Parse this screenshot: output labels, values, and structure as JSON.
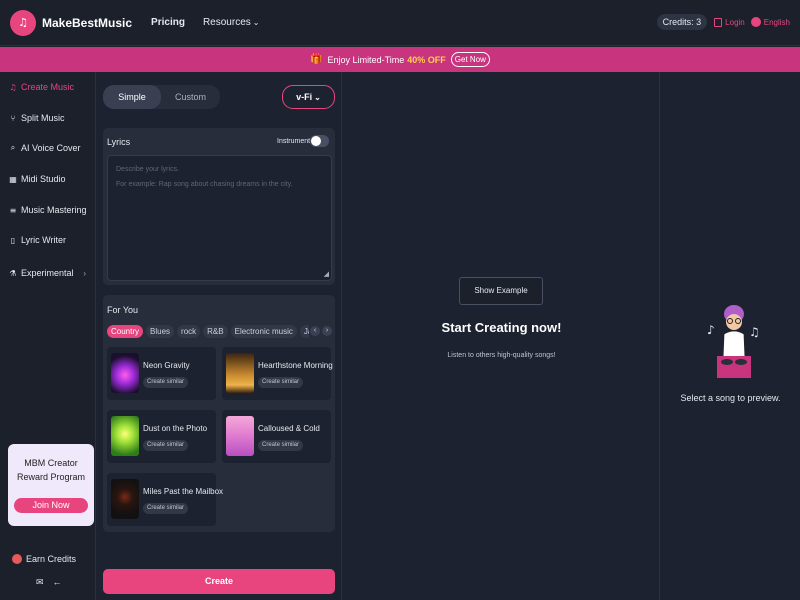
{
  "header": {
    "brand": "MakeBestMusic",
    "nav": [
      {
        "label": "Pricing"
      },
      {
        "label": "Resources"
      }
    ],
    "credits": "Credits: 3",
    "login": "Login",
    "language": "English"
  },
  "banner": {
    "prefix": "Enjoy Limited-Time",
    "highlight": "40% OFF",
    "cta": "Get Now"
  },
  "sidebar": {
    "items": [
      {
        "label": "Create Music",
        "icon": "music-note-icon",
        "active": true
      },
      {
        "label": "Split Music",
        "icon": "split-icon"
      },
      {
        "label": "AI Voice Cover",
        "icon": "microphone-icon"
      },
      {
        "label": "Midi Studio",
        "icon": "midi-icon"
      },
      {
        "label": "Music Mastering",
        "icon": "equalizer-icon"
      },
      {
        "label": "Lyric Writer",
        "icon": "document-icon"
      },
      {
        "label": "Experimental",
        "icon": "flask-icon"
      }
    ],
    "reward": {
      "line1": "MBM Creator",
      "line2": "Reward Program",
      "cta": "Join Now"
    },
    "earn_credits": "Earn Credits"
  },
  "composer": {
    "modes": {
      "simple": "Simple",
      "custom": "Custom"
    },
    "version": "v-Fi",
    "lyrics": {
      "title": "Lyrics",
      "instrumental": "Instrumental",
      "placeholder_line1": "Describe your lyrics.",
      "placeholder_line2": "For example: Rap song about chasing dreams in the city."
    },
    "for_you": {
      "title": "For You",
      "tags": [
        "Country",
        "Blues",
        "rock",
        "R&B",
        "Electronic music",
        "Ja"
      ],
      "songs": [
        {
          "name": "Neon Gravity",
          "similar": "Create similar"
        },
        {
          "name": "Hearthstone Morning",
          "similar": "Create similar"
        },
        {
          "name": "Dust on the Photo",
          "similar": "Create similar"
        },
        {
          "name": "Calloused & Cold",
          "similar": "Create similar"
        },
        {
          "name": "Miles Past the Mailbox",
          "similar": "Create similar"
        }
      ]
    },
    "create": "Create"
  },
  "main": {
    "show_example": "Show Example",
    "title": "Start Creating now!",
    "subtitle": "Listen to others high-quality songs!"
  },
  "preview": {
    "text": "Select a song to preview."
  },
  "colors": {
    "accent": "#e8457f",
    "background": "#1d2230",
    "banner": "#c8347d",
    "highlight": "#ffd34a"
  }
}
